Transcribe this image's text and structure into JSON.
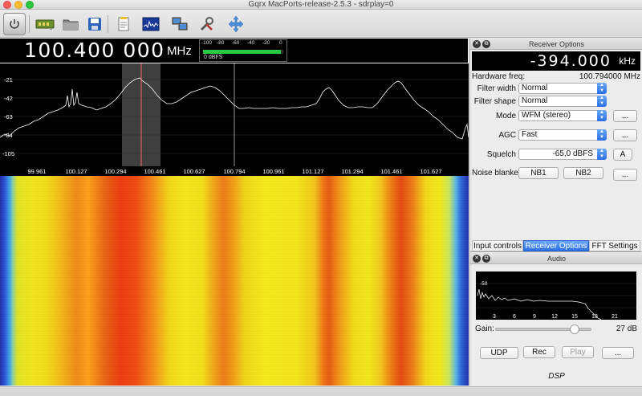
{
  "window": {
    "title": "Gqrx MacPorts-release-2.5.3 - sdrplay=0"
  },
  "colors": {
    "accent": "#2a6fe6",
    "meter_green": "#29c940",
    "spectrum_bg": "#000000"
  },
  "toolbar": {
    "items": [
      "power-icon",
      "device-icon",
      "folder-icon",
      "save-icon",
      "bookmark-icon",
      "fft-icon",
      "network-icon",
      "tools-icon",
      "move-icon"
    ]
  },
  "frequency": {
    "value": "100.400 000",
    "unit": "MHz"
  },
  "meter": {
    "ticks": [
      "-100",
      "-80",
      "-60",
      "-40",
      "-20",
      "0"
    ],
    "label": "0 dBFS",
    "level_fraction": 0.97
  },
  "spectrum": {
    "db_labels": [
      "-21",
      "-42",
      "-63",
      "-84",
      "-105"
    ],
    "freq_labels": [
      "99.961",
      "100.127",
      "100.294",
      "100.461",
      "100.627",
      "100.794",
      "100.961",
      "101.127",
      "101.294",
      "101.461",
      "101.627"
    ]
  },
  "receiver": {
    "panel_title": "Receiver Options",
    "offset": "-394.000",
    "offset_unit": "kHz",
    "hw_label": "Hardware freq:",
    "hw_value": "100.794000 MHz",
    "filter_width_label": "Filter width",
    "filter_width_value": "Normal",
    "filter_shape_label": "Filter shape",
    "filter_shape_value": "Normal",
    "mode_label": "Mode",
    "mode_value": "WFM (stereo)",
    "mode_more": "...",
    "agc_label": "AGC",
    "agc_value": "Fast",
    "agc_more": "...",
    "squelch_label": "Squelch",
    "squelch_value": "-65,0 dBFS",
    "squelch_auto": "A",
    "nb_label": "Noise blanker",
    "nb1": "NB1",
    "nb2": "NB2",
    "nb_more": "..."
  },
  "tabs": [
    "Input controls",
    "Receiver Options",
    "FFT Settings"
  ],
  "audio": {
    "panel_title": "Audio",
    "fft_db": "-50",
    "fft_ticks": [
      "3",
      "6",
      "9",
      "12",
      "15",
      "18",
      "21"
    ],
    "gain_label": "Gain:",
    "gain_value": "27 dB",
    "gain_fraction": 0.83,
    "udp": "UDP",
    "rec": "Rec",
    "play": "Play",
    "more": "...",
    "dsp": "DSP"
  }
}
